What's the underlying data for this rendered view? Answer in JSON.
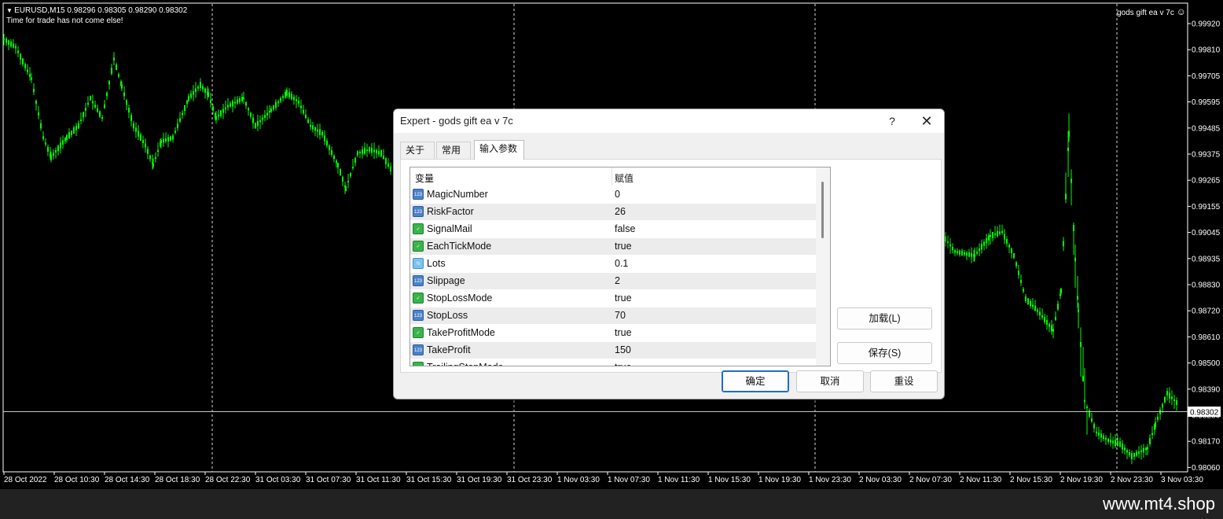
{
  "chart": {
    "header_line1": "EURUSD,M15  0.98296 0.98305 0.98290 0.98302",
    "header_line2": "Time for trade has not come else!",
    "ea_label": "gods gift ea v 7c",
    "ea_icon": "smiley-icon",
    "current_price": "0.98302",
    "candle_color": "#00ff00",
    "price_labels": [
      "0.99920",
      "0.99810",
      "0.99705",
      "0.99595",
      "0.99485",
      "0.99375",
      "0.99265",
      "0.99155",
      "0.99045",
      "0.98935",
      "0.98830",
      "0.98720",
      "0.98610",
      "0.98500",
      "0.98390",
      "0.98280",
      "0.98170",
      "0.98060"
    ],
    "time_labels": [
      "28 Oct 2022",
      "28 Oct 10:30",
      "28 Oct 14:30",
      "28 Oct 18:30",
      "28 Oct 22:30",
      "31 Oct 03:30",
      "31 Oct 07:30",
      "31 Oct 11:30",
      "31 Oct 15:30",
      "31 Oct 19:30",
      "31 Oct 23:30",
      "1 Nov 03:30",
      "1 Nov 07:30",
      "1 Nov 11:30",
      "1 Nov 15:30",
      "1 Nov 19:30",
      "1 Nov 23:30",
      "2 Nov 03:30",
      "2 Nov 07:30",
      "2 Nov 11:30",
      "2 Nov 15:30",
      "2 Nov 19:30",
      "2 Nov 23:30",
      "3 Nov 03:30"
    ]
  },
  "watermark": "www.mt4.shop",
  "dialog": {
    "title": "Expert - gods gift ea v 7c",
    "help": "?",
    "close": "✕",
    "tabs": [
      "关于",
      "常用",
      "输入参数"
    ],
    "active_tab": 2,
    "table": {
      "col_variable": "变量",
      "col_value": "赋值",
      "rows": [
        {
          "name": "MagicNumber",
          "value": "0",
          "type_icon": "int-icon",
          "icon_text": "123"
        },
        {
          "name": "RiskFactor",
          "value": "26",
          "type_icon": "int-icon",
          "icon_text": "123"
        },
        {
          "name": "SignalMail",
          "value": "false",
          "type_icon": "bool-icon",
          "icon_text": "✓"
        },
        {
          "name": "EachTickMode",
          "value": "true",
          "type_icon": "bool-icon",
          "icon_text": "✓"
        },
        {
          "name": "Lots",
          "value": "0.1",
          "type_icon": "double-icon",
          "icon_text": "½"
        },
        {
          "name": "Slippage",
          "value": "2",
          "type_icon": "int-icon",
          "icon_text": "123"
        },
        {
          "name": "StopLossMode",
          "value": "true",
          "type_icon": "bool-icon",
          "icon_text": "✓"
        },
        {
          "name": "StopLoss",
          "value": "70",
          "type_icon": "int-icon",
          "icon_text": "123"
        },
        {
          "name": "TakeProfitMode",
          "value": "true",
          "type_icon": "bool-icon",
          "icon_text": "✓"
        },
        {
          "name": "TakeProfit",
          "value": "150",
          "type_icon": "int-icon",
          "icon_text": "123"
        },
        {
          "name": "TrailingStopMode",
          "value": "true",
          "type_icon": "bool-icon",
          "icon_text": "✓"
        }
      ]
    },
    "buttons": {
      "load": "加载(L)",
      "save": "保存(S)",
      "ok": "确定",
      "cancel": "取消",
      "reset": "重设"
    }
  }
}
